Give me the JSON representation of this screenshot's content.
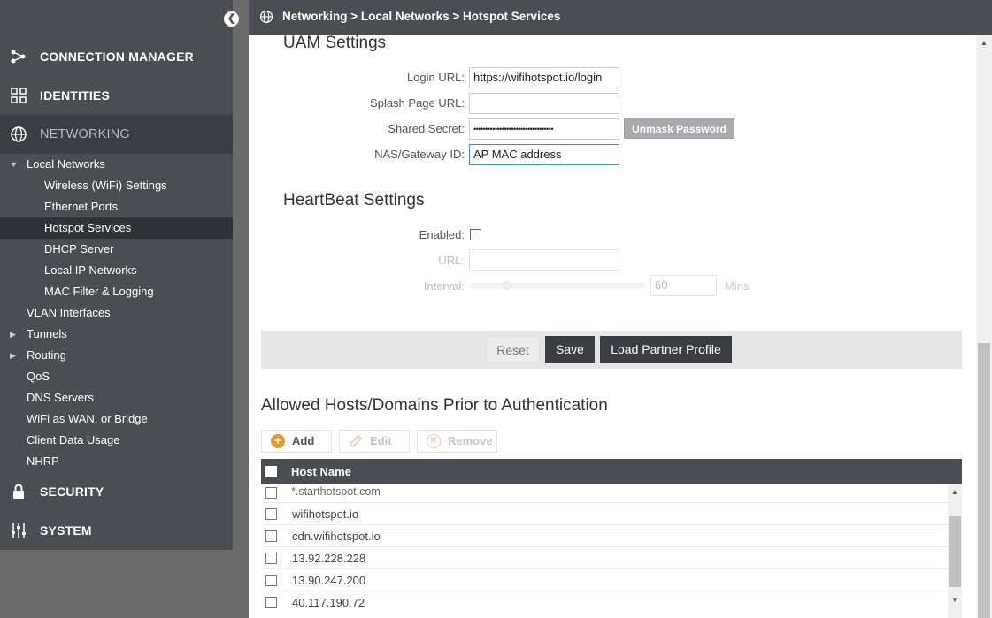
{
  "topbar": {
    "breadcrumb": "Networking > Local Networks > Hotspot Services"
  },
  "sidebar": {
    "collapse_icon": "chevron-left-icon",
    "sections": {
      "connection_manager": "CONNECTION MANAGER",
      "identities": "IDENTITIES",
      "networking": "NETWORKING",
      "security": "SECURITY",
      "system": "SYSTEM"
    },
    "local_networks": "Local Networks",
    "local_children": [
      "Wireless (WiFi) Settings",
      "Ethernet Ports",
      "Hotspot Services",
      "DHCP Server",
      "Local IP Networks",
      "MAC Filter & Logging"
    ],
    "items": [
      "VLAN Interfaces",
      "Tunnels",
      "Routing",
      "QoS",
      "DNS Servers",
      "WiFi as WAN, or Bridge",
      "Client Data Usage",
      "NHRP"
    ]
  },
  "uam": {
    "title": "UAM Settings",
    "login_url_label": "Login URL:",
    "login_url_value": "https://wifihotspot.io/login",
    "splash_label": "Splash Page URL:",
    "splash_value": "",
    "secret_label": "Shared Secret:",
    "secret_value": "••••••••••••••••••••••••••••••••••",
    "unmask_label": "Unmask Password",
    "nas_label": "NAS/Gateway ID:",
    "nas_value": "AP MAC address"
  },
  "heartbeat": {
    "title": "HeartBeat Settings",
    "enabled_label": "Enabled:",
    "enabled": false,
    "url_label": "URL:",
    "url_value": "",
    "interval_label": "Interval:",
    "interval_value": "60",
    "interval_unit": "Mins"
  },
  "actions": {
    "reset": "Reset",
    "save": "Save",
    "load_partner": "Load Partner Profile"
  },
  "allowed": {
    "title": "Allowed Hosts/Domains Prior to Authentication",
    "add": "Add",
    "edit": "Edit",
    "remove": "Remove",
    "column": "Host Name",
    "rows": [
      "*.starthotspot.com",
      "wifihotspot.io",
      "cdn.wifihotspot.io",
      "13.92.228.228",
      "13.90.247.200",
      "40.117.190.72"
    ]
  },
  "colors": {
    "sidebar": "#4a4d52",
    "dark_button": "#3a3d42",
    "add_icon": "#e8952b"
  }
}
